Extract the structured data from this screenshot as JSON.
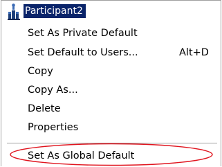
{
  "header": {
    "title": "Participant2",
    "icon": "participant-icon",
    "highlight_color": "#0a246a"
  },
  "menu": {
    "items": [
      {
        "label": "Set As Private Default",
        "shortcut": ""
      },
      {
        "label": "Set Default to Users...",
        "shortcut": "Alt+D"
      },
      {
        "label": "Copy",
        "shortcut": ""
      },
      {
        "label": "Copy As...",
        "shortcut": ""
      },
      {
        "label": "Delete",
        "shortcut": ""
      },
      {
        "label": "Properties",
        "shortcut": ""
      }
    ],
    "global_default": {
      "label": "Set As Global Default"
    }
  },
  "annotation": {
    "shape": "ellipse",
    "color": "#e0141e"
  }
}
